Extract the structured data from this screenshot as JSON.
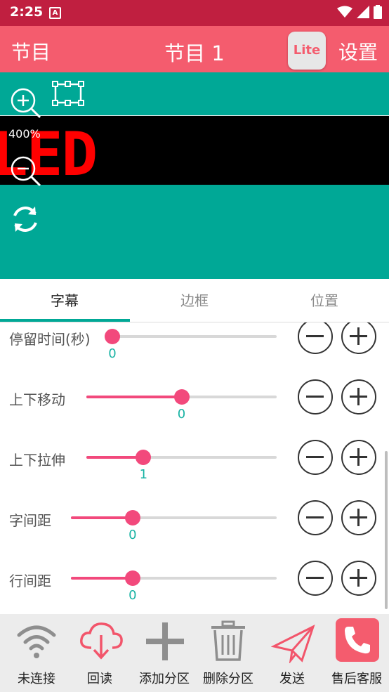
{
  "status_bar": {
    "time": "2:25",
    "notification_glyph": "A"
  },
  "app_bar": {
    "left_label": "节目",
    "title": "节目 1",
    "lite_badge": "Lite",
    "right_label": "设置"
  },
  "preview": {
    "zoom_level": "400%",
    "led_text": "LED"
  },
  "tabs": [
    {
      "label": "字幕",
      "active": true
    },
    {
      "label": "边框",
      "active": false
    },
    {
      "label": "位置",
      "active": false
    }
  ],
  "settings": [
    {
      "label": "停留时间(秒)",
      "value": "0",
      "fraction": 0.0
    },
    {
      "label": "上下移动",
      "value": "0",
      "fraction": 0.5
    },
    {
      "label": "上下拉伸",
      "value": "1",
      "fraction": 0.3
    },
    {
      "label": "字间距",
      "value": "0",
      "fraction": 0.3
    },
    {
      "label": "行间距",
      "value": "0",
      "fraction": 0.3
    }
  ],
  "bottom_nav": [
    {
      "label": "未连接",
      "icon": "wifi-icon"
    },
    {
      "label": "回读",
      "icon": "cloud-download-icon"
    },
    {
      "label": "添加分区",
      "icon": "plus-icon"
    },
    {
      "label": "删除分区",
      "icon": "trash-icon"
    },
    {
      "label": "发送",
      "icon": "paper-plane-icon"
    },
    {
      "label": "售后客服",
      "icon": "phone-icon"
    }
  ],
  "colors": {
    "status_bar": "#c01f40",
    "app_bar": "#f45c6e",
    "preview_bg": "#00a896",
    "slider_active": "#f2497c",
    "value_text": "#19b3a4"
  }
}
